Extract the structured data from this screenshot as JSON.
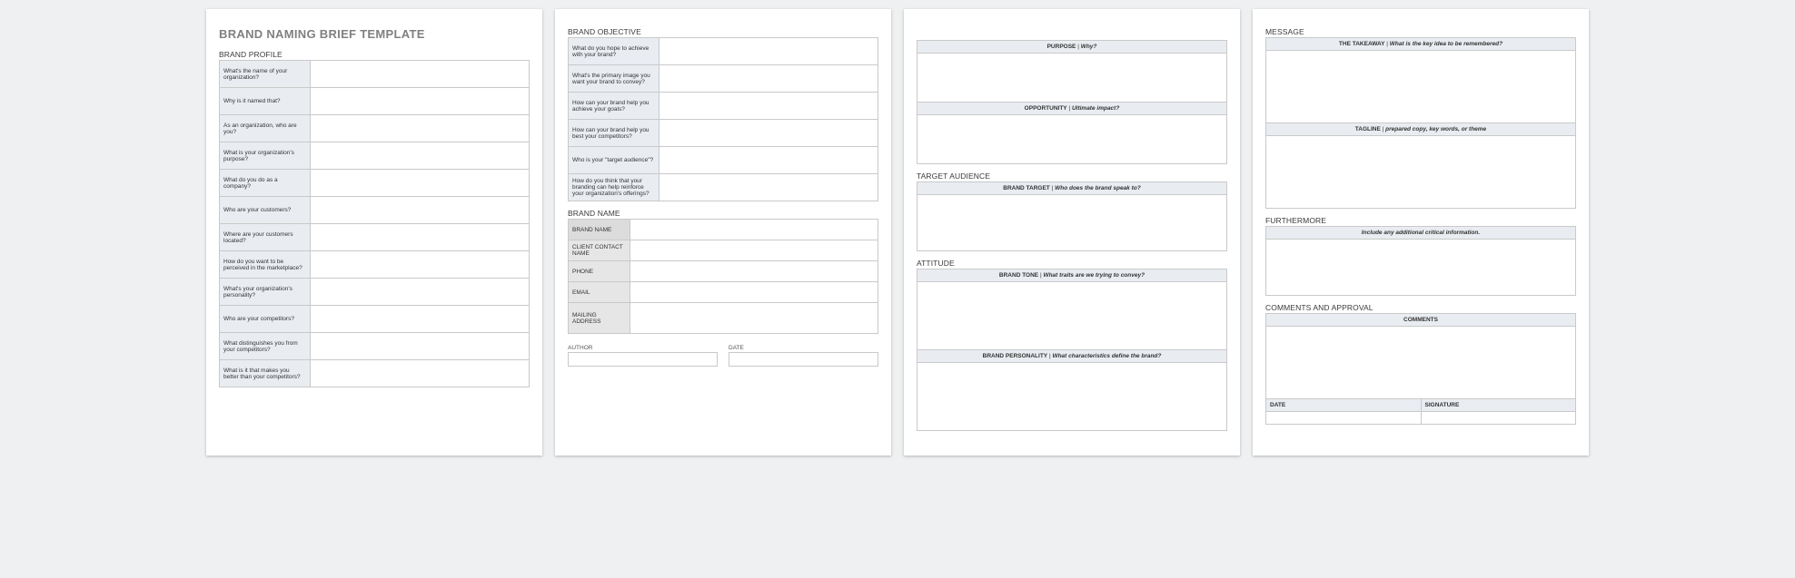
{
  "doc_title": "BRAND NAMING BRIEF TEMPLATE",
  "brand_profile": {
    "title": "BRAND PROFILE",
    "rows": [
      "What's the name of your organization?",
      "Why is it named that?",
      "As an organization, who are you?",
      "What is your organization's purpose?",
      "What do you do as a company?",
      "Who are your customers?",
      "Where are your customers located?",
      "How do you want to be perceived in the marketplace?",
      "What's your organization's personality?",
      "Who are your competitors?",
      "What distinguishes you from your competitors?",
      "What is it that makes you better than your competitors?"
    ]
  },
  "brand_objective": {
    "title": "BRAND OBJECTIVE",
    "rows": [
      "What do you hope to achieve with your brand?",
      "What's the primary image you want your brand to convey?",
      "How can your brand help you achieve your goals?",
      "How can your brand help you best your competitors?",
      "Who is your \"target audience\"?",
      "How do you think that your branding can help reinforce your organization's offerings?"
    ]
  },
  "brand_name": {
    "title": "BRAND NAME",
    "rows": [
      "BRAND NAME",
      "CLIENT CONTACT NAME",
      "PHONE",
      "EMAIL",
      "MAILING ADDRESS"
    ]
  },
  "author_label": "AUTHOR",
  "date_label": "DATE",
  "purpose": {
    "bold": "PURPOSE",
    "sep": "  |  ",
    "italic": "Why?"
  },
  "opportunity": {
    "bold": "OPPORTUNITY",
    "sep": "  |  ",
    "italic": "Ultimate impact?"
  },
  "target_audience": {
    "title": "TARGET AUDIENCE",
    "header": {
      "bold": "BRAND TARGET",
      "sep": "  |  ",
      "italic": "Who does the brand speak to?"
    }
  },
  "attitude": {
    "title": "ATTITUDE",
    "tone": {
      "bold": "BRAND TONE",
      "sep": "  |  ",
      "italic": "What traits are we trying to convey?"
    },
    "personality": {
      "bold": "BRAND PERSONALITY",
      "sep": "  |  ",
      "italic": "What characteristics define the brand?"
    }
  },
  "message": {
    "title": "MESSAGE",
    "takeaway": {
      "bold": "THE TAKEAWAY",
      "sep": "  |  ",
      "italic": "What is the key idea to be remembered?"
    },
    "tagline": {
      "bold": "TAGLINE",
      "sep": " |  ",
      "italic": "prepared copy, key words, or theme"
    }
  },
  "furthermore": {
    "title": "FURTHERMORE",
    "header": "Include any additional critical information."
  },
  "comments": {
    "title": "COMMENTS AND APPROVAL",
    "comments_label": "COMMENTS",
    "date_label": "DATE",
    "signature_label": "SIGNATURE"
  }
}
